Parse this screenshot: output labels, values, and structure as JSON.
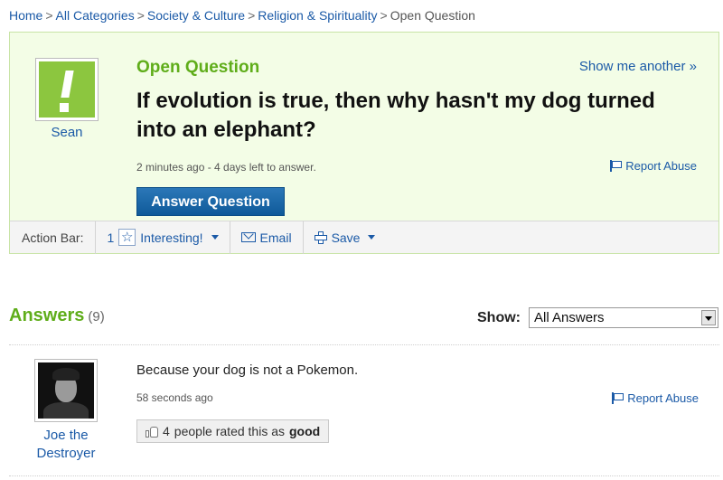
{
  "breadcrumb": {
    "items": [
      "Home",
      "All Categories",
      "Society & Culture",
      "Religion & Spirituality"
    ],
    "current": "Open Question",
    "separator": ">"
  },
  "question": {
    "status": "Open Question",
    "show_another": "Show me another »",
    "title": "If evolution is true, then why hasn't my dog turned into an elephant?",
    "meta": "2 minutes ago - 4 days left to answer.",
    "report": "Report Abuse",
    "answer_button": "Answer Question",
    "asker": {
      "name": "Sean",
      "avatar_icon": "exclamation-avatar-icon"
    }
  },
  "action_bar": {
    "label": "Action Bar:",
    "interesting_count": "1",
    "interesting_label": "Interesting!",
    "email_label": "Email",
    "save_label": "Save"
  },
  "answers": {
    "heading": "Answers",
    "count": "(9)",
    "show_label": "Show:",
    "filter_value": "All Answers",
    "items": [
      {
        "text": "Because your dog is not a Pokemon.",
        "meta": "58 seconds ago",
        "report": "Report Abuse",
        "rating_count": "4",
        "rating_prefix": "people rated this as",
        "rating_word": "good",
        "author_line1": "Joe the",
        "author_line2": "Destroyer"
      }
    ]
  },
  "colors": {
    "accent_green": "#5fad1a",
    "link_blue": "#1b5aa7",
    "card_bg": "#f3fde6",
    "button_blue": "#1a65a6"
  }
}
